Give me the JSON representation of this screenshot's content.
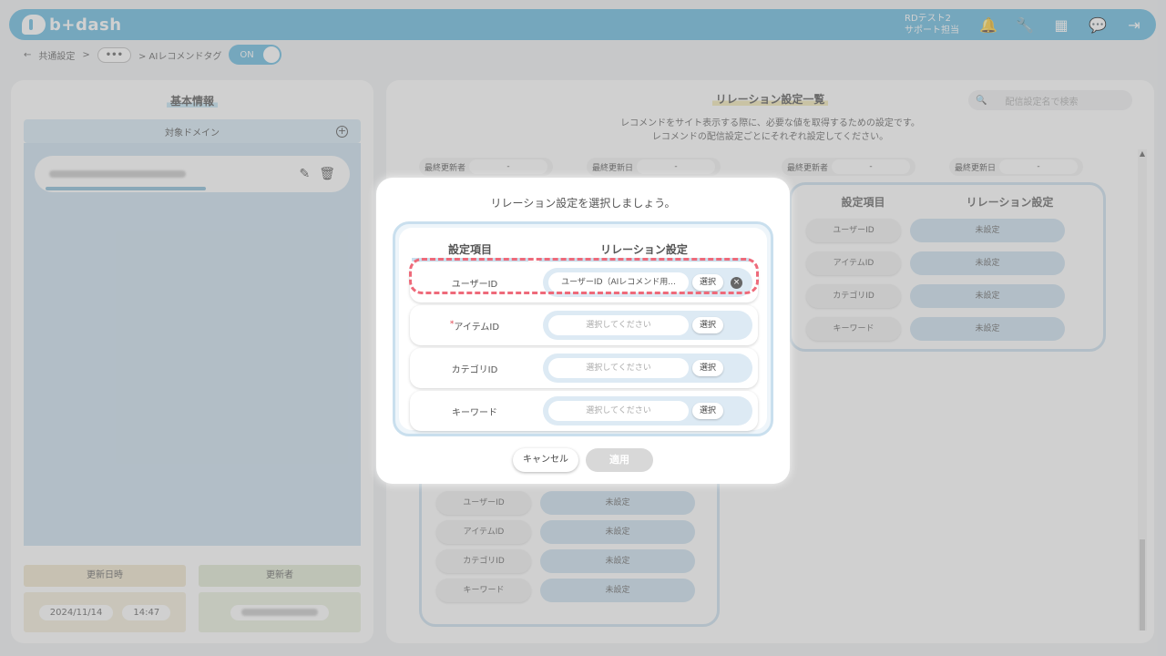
{
  "app": {
    "logo_text": "b+dash"
  },
  "header": {
    "user_line1": "RDテスト2",
    "user_line2": "サポート担当",
    "icons": [
      "bell-icon",
      "wrench-icon",
      "grid-icon",
      "chat-icon",
      "logout-icon"
    ]
  },
  "breadcrumb": {
    "back": "←",
    "item1": "共通設定",
    "sep": ">",
    "more": "•••",
    "item2": "> AIレコメンドタグ",
    "toggle": "ON"
  },
  "left": {
    "title": "基本情報",
    "domain_header": "対象ドメイン",
    "plus": "+",
    "updated_at_label": "更新日時",
    "updated_by_label": "更新者",
    "date": "2024/11/14",
    "time": "14:47"
  },
  "right": {
    "title": "リレーション設定一覧",
    "search_placeholder": "配信設定名で検索",
    "desc1": "レコメンドをサイト表示する際に、必要な値を取得するための設定です。",
    "desc2": "レコメンドの配信設定ごとにそれぞれ設定してください。",
    "last_editor_label": "最終更新者",
    "last_updated_label": "最終更新日",
    "dash": "-",
    "col_item": "設定項目",
    "col_relation": "リレーション設定",
    "rows": [
      {
        "item": "ユーザーID",
        "value": "未設定"
      },
      {
        "item": "アイテムID",
        "value": "未設定"
      },
      {
        "item": "カテゴリID",
        "value": "未設定"
      },
      {
        "item": "キーワード",
        "value": "未設定"
      }
    ]
  },
  "modal": {
    "title": "リレーション設定を選択しましょう。",
    "col_item": "設定項目",
    "col_relation": "リレーション設定",
    "select_label": "選択",
    "required_mark": "*",
    "clear_symbol": "×",
    "rows": [
      {
        "label": "ユーザーID",
        "value": "ユーザーID（AIレコメンド用..."
      },
      {
        "label": "アイテムID",
        "value": "選択してください"
      },
      {
        "label": "カテゴリID",
        "value": "選択してください"
      },
      {
        "label": "キーワード",
        "value": "選択してください"
      }
    ],
    "cancel": "キャンセル",
    "apply": "適用"
  }
}
